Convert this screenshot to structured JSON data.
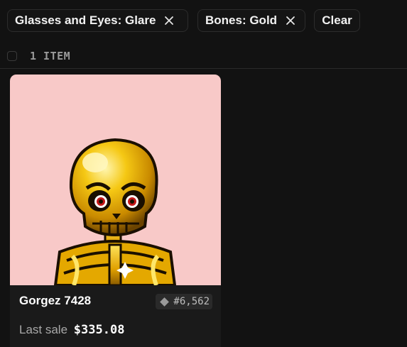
{
  "filters": {
    "chips": [
      {
        "label": "Glasses and Eyes: Glare"
      },
      {
        "label": "Bones: Gold"
      }
    ],
    "clear_label": "Clear"
  },
  "results": {
    "count_label": "1 ITEM"
  },
  "card": {
    "name": "Gorgez 7428",
    "rank": "#6,562",
    "last_sale_label": "Last sale",
    "last_sale_price": "$335.08",
    "art_background": "#f8c9c8",
    "rank_icon": "diamond-icon"
  }
}
